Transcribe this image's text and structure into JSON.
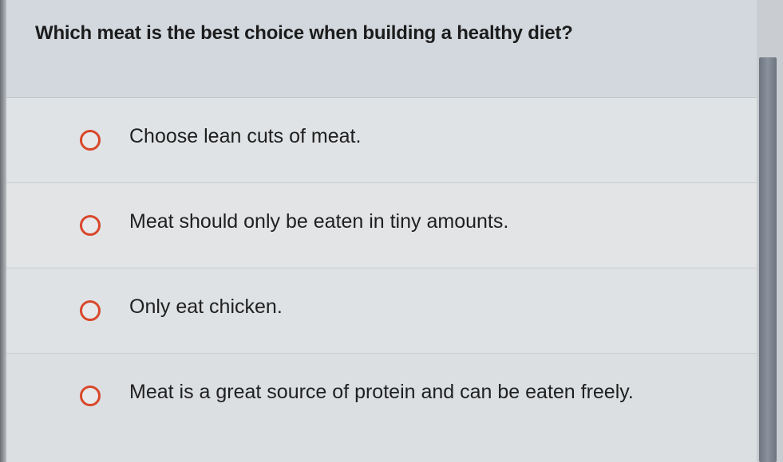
{
  "question": {
    "text": "Which meat is the best choice when building a healthy diet?"
  },
  "options": [
    {
      "label": "Choose lean cuts of meat.",
      "selected": false
    },
    {
      "label": "Meat should only be eaten in tiny amounts.",
      "selected": false
    },
    {
      "label": "Only eat chicken.",
      "selected": false
    },
    {
      "label": "Meat is a great source of protein and can be eaten freely.",
      "selected": false
    }
  ],
  "colors": {
    "radio_border": "#d9472b",
    "header_bg": "#d2d8de",
    "option_bg": "#e0e3e5",
    "scrollbar_thumb": "#7a828c"
  }
}
